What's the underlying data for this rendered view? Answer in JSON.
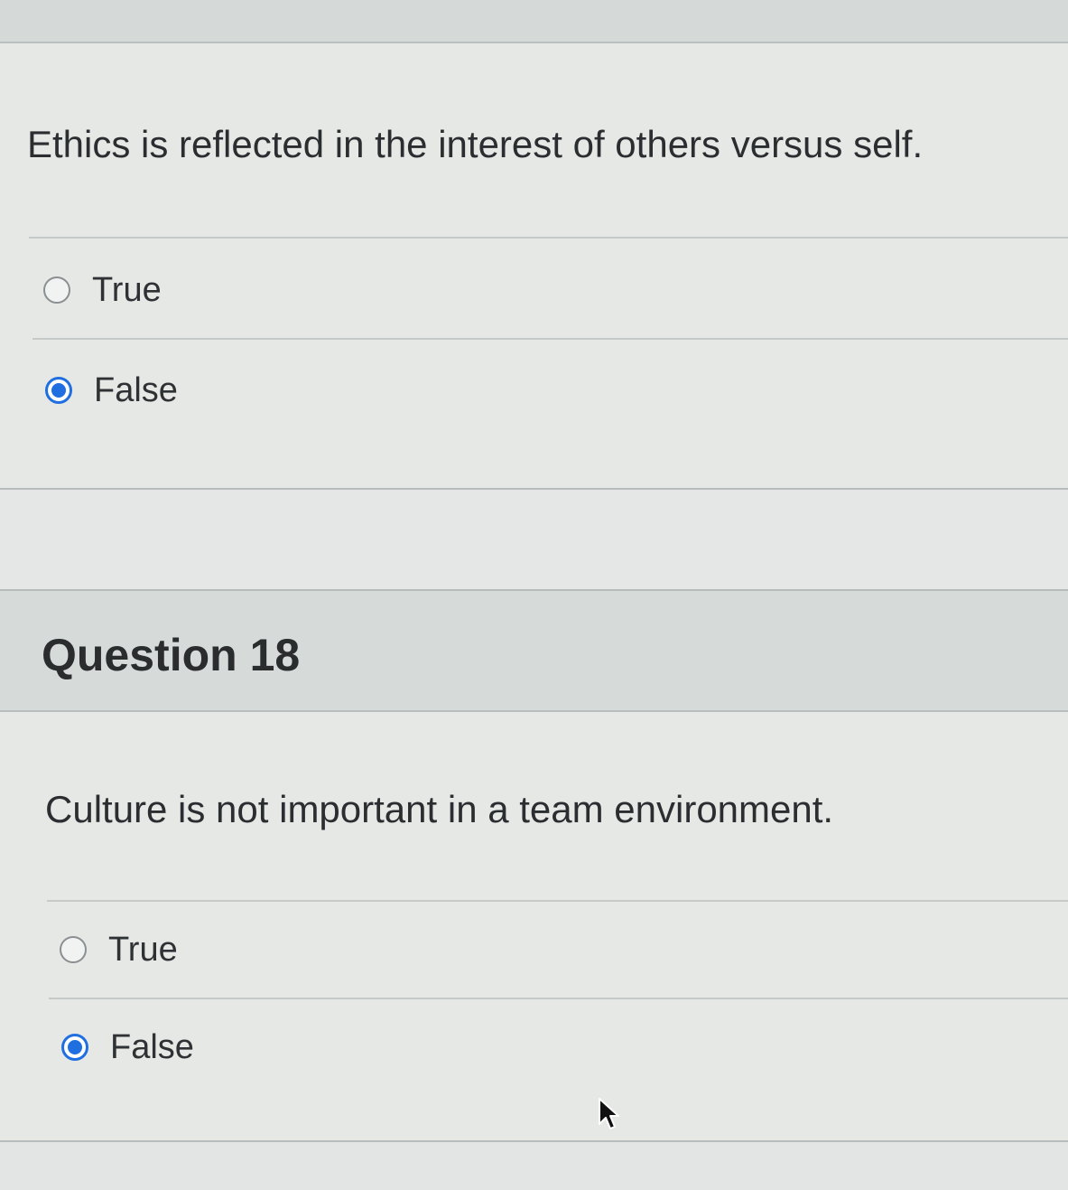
{
  "question_17": {
    "prompt": "Ethics is reflected in the interest of others versus self.",
    "options": [
      {
        "label": "True",
        "selected": false
      },
      {
        "label": "False",
        "selected": true
      }
    ]
  },
  "question_18": {
    "title": "Question 18",
    "prompt": "Culture is not important in a team environment.",
    "options": [
      {
        "label": "True",
        "selected": false
      },
      {
        "label": "False",
        "selected": true
      }
    ]
  },
  "colors": {
    "accent": "#1f6fe0",
    "header_band": "#d6dbda",
    "panel": "#e6e8e6"
  },
  "icons": {
    "radio_unselected": "radio-unselected-icon",
    "radio_selected": "radio-selected-icon",
    "cursor": "mouse-pointer-icon"
  }
}
